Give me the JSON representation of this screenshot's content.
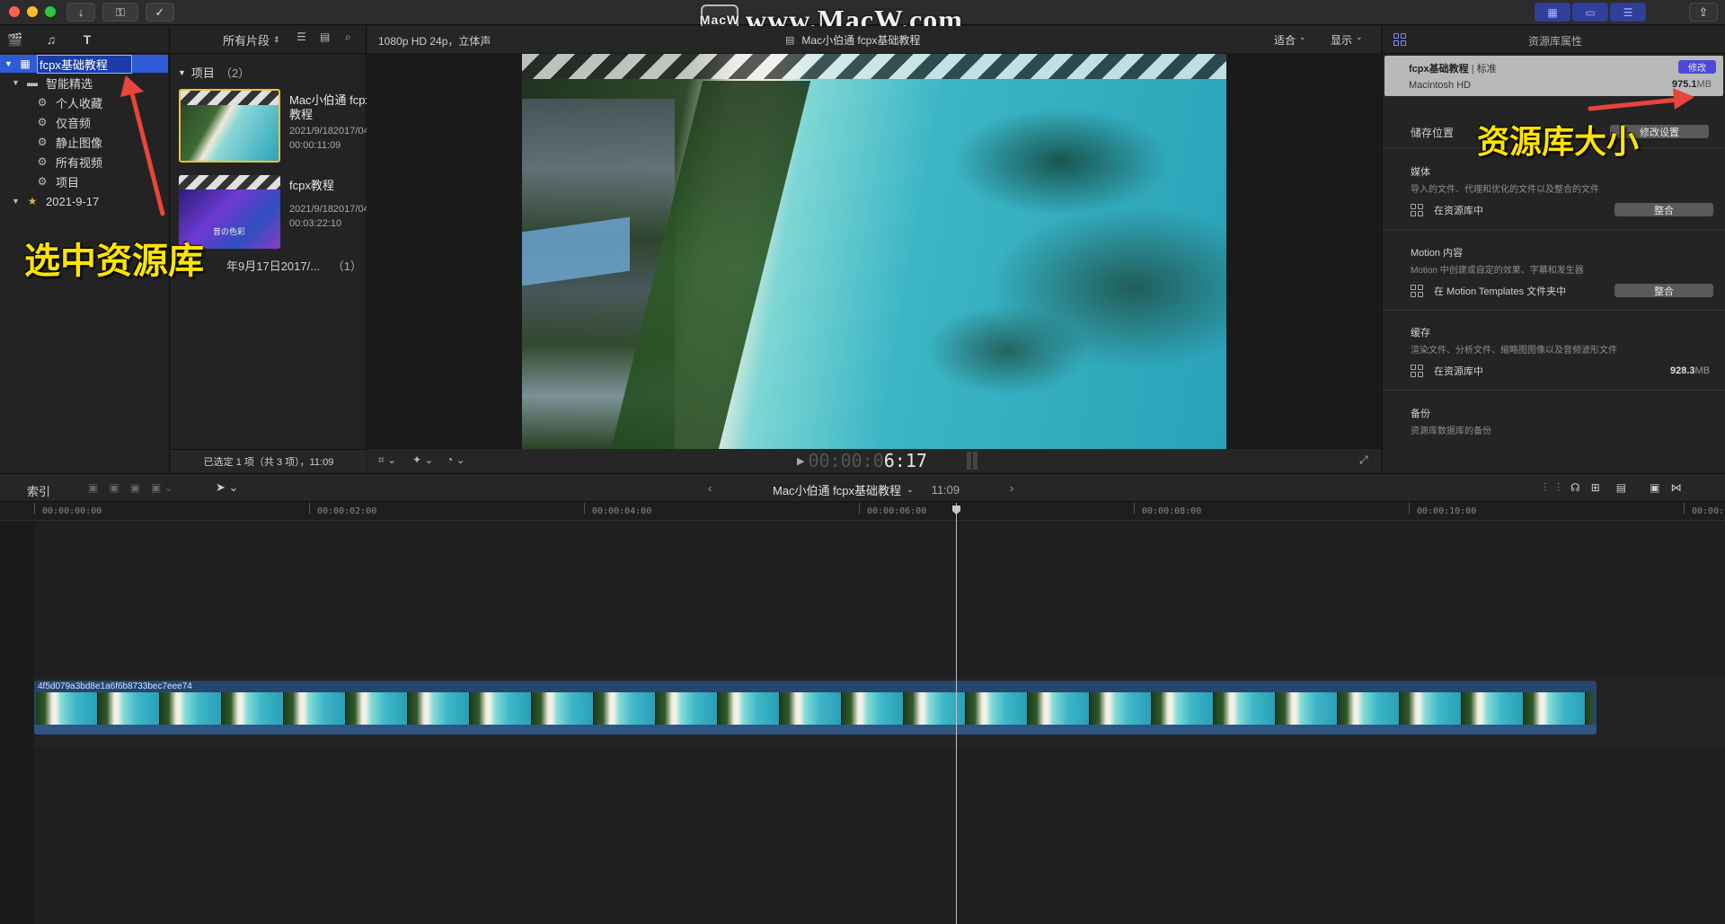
{
  "watermark": {
    "logo_text": "MacW",
    "text": "www.MacW.com"
  },
  "sidebar": {
    "library_name": "fcpx基础教程",
    "smart_collections_label": "智能精选",
    "smart_items": [
      "个人收藏",
      "仅音频",
      "静止图像",
      "所有视频",
      "项目"
    ],
    "event_name": "2021-9-17"
  },
  "browser": {
    "filter_label": "所有片段",
    "section_title": "项目",
    "section_count": "（2）",
    "clips": [
      {
        "title_line1": "Mac小伯通 fcpx",
        "title_line2": "教程",
        "date": "2021/9/182017/04",
        "duration": "00:00:11:09"
      },
      {
        "title_line1": "fcpx教程",
        "title_line2": "",
        "date": "2021/9/182017/04",
        "duration": "00:03:22:10",
        "thumb_caption": "昔の色彩"
      }
    ],
    "group_label": "年9月17日2017/...",
    "group_count": "（1）",
    "status": "已选定 1 项（共 3 项），11:09"
  },
  "viewer": {
    "format": "1080p HD 24p，立体声",
    "project_title": "Mac小伯通 fcpx基础教程",
    "fit_label": "适合",
    "display_label": "显示",
    "timecode_dim": "00:00:0",
    "timecode_bright": "6:17"
  },
  "inspector": {
    "header": "资源库属性",
    "library_name": "fcpx基础教程",
    "library_type": "标准",
    "modify_label": "修改",
    "disk_name": "Macintosh HD",
    "disk_size_value": "975.1",
    "disk_size_unit": "MB",
    "storage_label": "储存位置",
    "modify_settings_label": "修改设置",
    "media_title": "媒体",
    "media_desc": "导入的文件、代理和优化的文件以及整合的文件",
    "media_location": "在资源库中",
    "consolidate_label": "整合",
    "motion_title": "Motion 内容",
    "motion_desc": "Motion 中创建或自定的效果、字幕和发生器",
    "motion_location": "在 Motion Templates 文件夹中",
    "cache_title": "缓存",
    "cache_desc": "渲染文件、分析文件、缩略图图像以及音频波形文件",
    "cache_location": "在资源库中",
    "cache_size_value": "928.3",
    "cache_size_unit": "MB",
    "backup_title": "备份",
    "backup_desc": "资源库数据库的备份"
  },
  "timeline": {
    "index_label": "索引",
    "project_title": "Mac小伯通 fcpx基础教程",
    "duration": "11:09",
    "ruler": [
      "00:00:00:00",
      "00:00:02:00",
      "00:00:04:00",
      "00:00:06:00",
      "00:00:08:00",
      "00:00:10:00",
      "00:00:1"
    ],
    "clip_name": "4f5d079a3bd8e1a6f6b8733bec7eee74"
  },
  "annotations": {
    "select_library": "选中资源库",
    "library_size": "资源库大小"
  },
  "colors": {
    "accent_blue": "#2f5bd6",
    "annotation_yellow": "#ffe400",
    "annotation_arrow": "#e8453c",
    "clip_blue": "#27466d"
  }
}
